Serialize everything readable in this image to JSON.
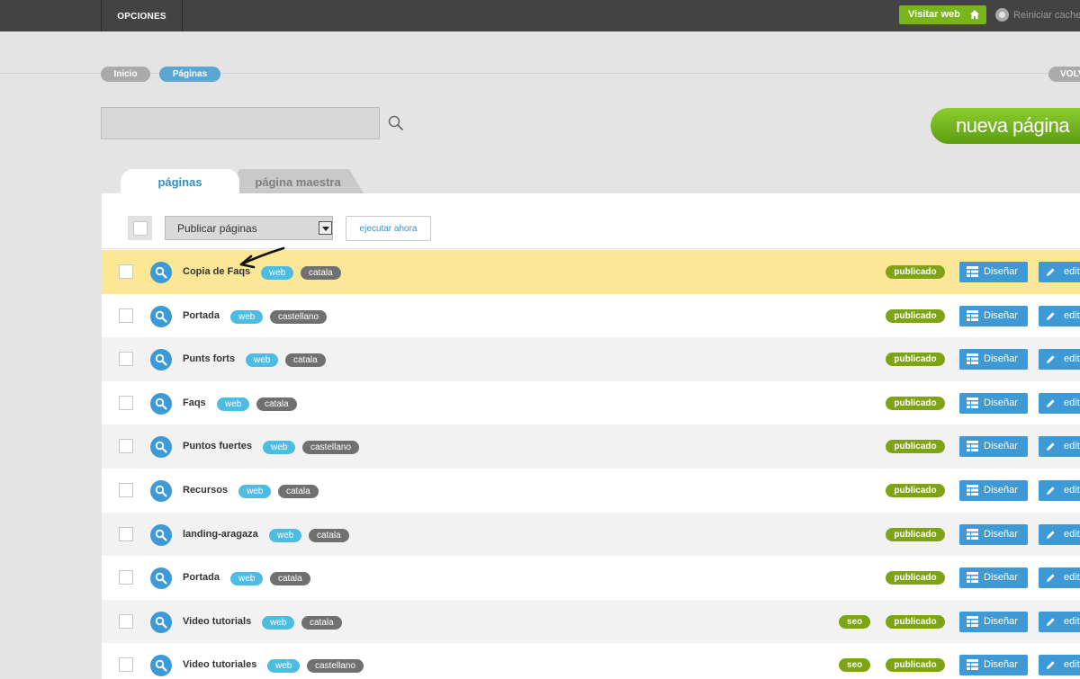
{
  "topbar": {
    "opciones_label": "OPCIONES",
    "visit_label": "Visitar web",
    "reset_label": "Reiniciar cache"
  },
  "breadcrumb": {
    "inicio": "Inicio",
    "paginas": "Páginas",
    "volver": "VOLVER"
  },
  "search": {
    "value": "",
    "placeholder": ""
  },
  "new_page_label": "nueva página",
  "tabs": [
    {
      "label": "páginas",
      "active": true
    },
    {
      "label": "página maestra",
      "active": false
    }
  ],
  "toolbar": {
    "bulk_action": "Publicar páginas",
    "run_label": "ejecutar ahora"
  },
  "row_actions": {
    "design_label": "Diseñar",
    "edit_label": "editar"
  },
  "rows": [
    {
      "name": "Copia de Faqs",
      "tag1": "web",
      "tag2": "catala",
      "seo": "",
      "status": "publicado",
      "highlighted": true
    },
    {
      "name": "Portada",
      "tag1": "web",
      "tag2": "castellano",
      "seo": "",
      "status": "publicado"
    },
    {
      "name": "Punts forts",
      "tag1": "web",
      "tag2": "catala",
      "seo": "",
      "status": "publicado"
    },
    {
      "name": "Faqs",
      "tag1": "web",
      "tag2": "catala",
      "seo": "",
      "status": "publicado"
    },
    {
      "name": "Puntos fuertes",
      "tag1": "web",
      "tag2": "castellano",
      "seo": "",
      "status": "publicado"
    },
    {
      "name": "Recursos",
      "tag1": "web",
      "tag2": "catala",
      "seo": "",
      "status": "publicado"
    },
    {
      "name": "landing-aragaza",
      "tag1": "web",
      "tag2": "catala",
      "seo": "",
      "status": "publicado"
    },
    {
      "name": "Portada",
      "tag1": "web",
      "tag2": "catala",
      "seo": "",
      "status": "publicado"
    },
    {
      "name": "Video tutorials",
      "tag1": "web",
      "tag2": "catala",
      "seo": "seo",
      "status": "publicado"
    },
    {
      "name": "Video tutoriales",
      "tag1": "web",
      "tag2": "castellano",
      "seo": "seo",
      "status": "publicado"
    }
  ],
  "colors": {
    "topbar": "#434343",
    "accent_blue": "#3d9ad6",
    "status_green": "#7ea315",
    "new_page_green": "#79b41c",
    "highlight_row": "#fbe796"
  },
  "icons": [
    "home-icon",
    "refresh-icon",
    "search-icon",
    "magnifier-icon",
    "layout-grid-icon",
    "pencil-icon",
    "dropdown-arrow-icon"
  ]
}
